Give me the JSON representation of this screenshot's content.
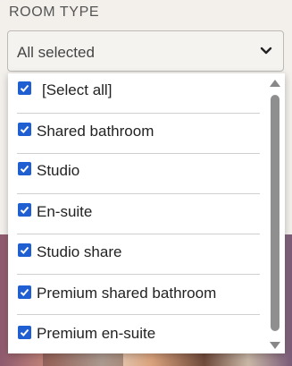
{
  "field": {
    "label": "ROOM TYPE",
    "value": "All selected",
    "chevron_icon": "chevron-down-icon"
  },
  "options": [
    {
      "label": "[Select all]",
      "checked": true
    },
    {
      "label": "Shared bathroom",
      "checked": true
    },
    {
      "label": "Studio",
      "checked": true
    },
    {
      "label": "En-suite",
      "checked": true
    },
    {
      "label": "Studio share",
      "checked": true
    },
    {
      "label": "Premium shared bathroom",
      "checked": true
    },
    {
      "label": "Premium en-suite",
      "checked": true
    }
  ],
  "colors": {
    "checkbox": "#1f5fd1",
    "background": "#f3f0ec"
  }
}
